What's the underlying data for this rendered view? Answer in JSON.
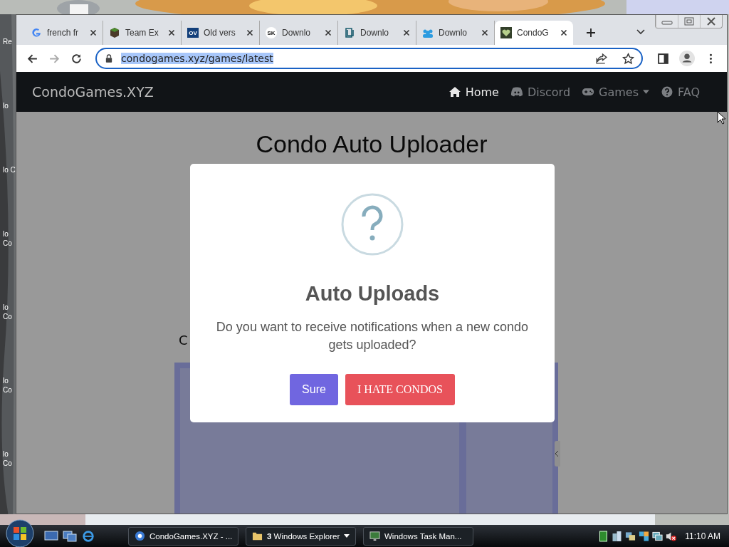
{
  "desktop": {
    "labels": [
      "Re",
      "lo",
      "lo C",
      "lo Co",
      "lo Co",
      "lo Co",
      "lo Co"
    ]
  },
  "browser": {
    "tabs": [
      {
        "title": "french fr",
        "kind": "google",
        "selected": false
      },
      {
        "title": "Team Ex",
        "kind": "block",
        "selected": false
      },
      {
        "title": "Old vers",
        "kind": "ov",
        "badge": "OV",
        "selected": false
      },
      {
        "title": "Downlo",
        "kind": "sk",
        "badge": "SK",
        "selected": false
      },
      {
        "title": "Downlo",
        "kind": "doc",
        "selected": false
      },
      {
        "title": "Downlo",
        "kind": "people",
        "selected": false
      },
      {
        "title": "CondoG",
        "kind": "heart",
        "selected": true
      }
    ],
    "address": {
      "url": "condogames.xyz/games/latest",
      "highlighted": true
    }
  },
  "navbar": {
    "brand": "CondoGames.XYZ",
    "links": [
      {
        "label": "Home",
        "kind": "home",
        "selected": true,
        "dropdown": false
      },
      {
        "label": "Discord",
        "kind": "discord",
        "selected": false,
        "dropdown": false
      },
      {
        "label": "Games",
        "kind": "gamepad",
        "selected": false,
        "dropdown": true
      },
      {
        "label": "FAQ",
        "kind": "question",
        "selected": false,
        "dropdown": false
      }
    ]
  },
  "page": {
    "heading": "Condo Auto Uploader",
    "label": "C"
  },
  "modal": {
    "title": "Auto Uploads",
    "message": "Do you want to receive notifications when a new condo gets uploaded?",
    "buttons": [
      {
        "label": "Sure",
        "kind": "confirm"
      },
      {
        "label": "I HATE CONDOS",
        "kind": "cancel"
      }
    ]
  },
  "taskbar": {
    "tasks": [
      {
        "label": "CondoGames.XYZ - ...",
        "kind": "chrome",
        "dropdown": false
      },
      {
        "label": "**3** Windows Explorer",
        "kind": "folder",
        "dropdown": true
      },
      {
        "label": "Windows Task Man...",
        "kind": "monitor",
        "dropdown": false
      }
    ],
    "clock": "11:10 AM"
  }
}
